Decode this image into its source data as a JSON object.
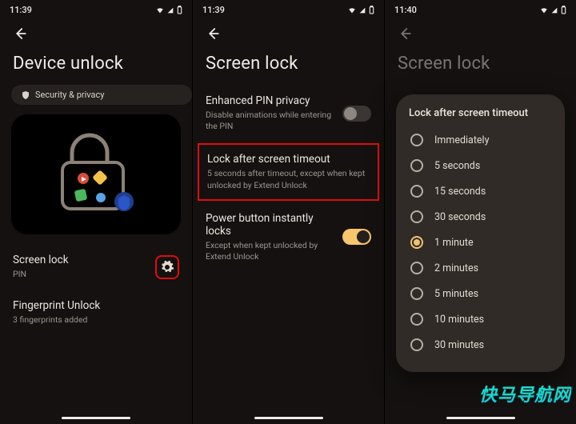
{
  "status": {
    "time1": "11:39",
    "time2": "11:39",
    "time3": "11:40"
  },
  "p1": {
    "title": "Device unlock",
    "chip": "Security & privacy",
    "screenLock": {
      "title": "Screen lock",
      "subtitle": "PIN"
    },
    "fingerprint": {
      "title": "Fingerprint Unlock",
      "subtitle": "3 fingerprints added"
    }
  },
  "p2": {
    "title": "Screen lock",
    "rows": {
      "pin": {
        "title": "Enhanced PIN privacy",
        "subtitle": "Disable animations while entering the PIN"
      },
      "timeout": {
        "title": "Lock after screen timeout",
        "subtitle": "5 seconds after timeout, except when kept unlocked by Extend Unlock"
      },
      "power": {
        "title": "Power button instantly locks",
        "subtitle": "Except when kept unlocked by Extend Unlock"
      }
    }
  },
  "p3": {
    "title": "Screen lock",
    "dialogTitle": "Lock after screen timeout",
    "options": [
      "Immediately",
      "5 seconds",
      "15 seconds",
      "30 seconds",
      "1 minute",
      "2 minutes",
      "5 minutes",
      "10 minutes",
      "30 minutes"
    ],
    "selectedIndex": 4
  },
  "watermark": "快马导航网"
}
